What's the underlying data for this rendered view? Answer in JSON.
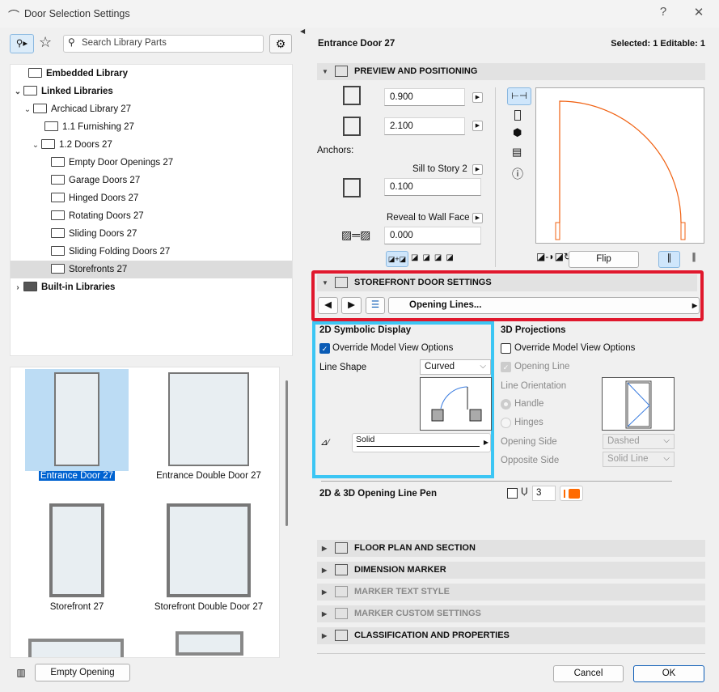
{
  "window": {
    "title": "Door Selection Settings",
    "help": "?",
    "close": "✕"
  },
  "left": {
    "search_placeholder": "Search Library Parts",
    "tree": [
      {
        "label": "Embedded Library",
        "bold": true
      },
      {
        "label": "Linked Libraries",
        "bold": true
      },
      {
        "label": "Archicad Library 27"
      },
      {
        "label": "1.1 Furnishing 27"
      },
      {
        "label": "1.2 Doors 27"
      },
      {
        "label": "Empty Door Openings 27"
      },
      {
        "label": "Garage Doors 27"
      },
      {
        "label": "Hinged Doors 27"
      },
      {
        "label": "Rotating Doors 27"
      },
      {
        "label": "Sliding Doors 27"
      },
      {
        "label": "Sliding Folding Doors 27"
      },
      {
        "label": "Storefronts 27",
        "selected": true
      },
      {
        "label": "Built-in Libraries",
        "bold": true
      }
    ],
    "thumbs": [
      {
        "label": "Entrance Door 27",
        "selected": true
      },
      {
        "label": "Entrance Double Door 27"
      },
      {
        "label": "Storefront 27"
      },
      {
        "label": "Storefront Double Door 27"
      }
    ],
    "empty_opening": "Empty Opening"
  },
  "right": {
    "element_name": "Entrance Door 27",
    "selection_info": "Selected: 1 Editable: 1",
    "preview": {
      "header": "PREVIEW AND POSITIONING",
      "width": "0.900",
      "height": "2.100",
      "anchors_label": "Anchors:",
      "sill_label": "Sill to Story 2",
      "sill_value": "0.100",
      "reveal_label": "Reveal to Wall Face",
      "reveal_value": "0.000",
      "flip": "Flip"
    },
    "storefront": {
      "header": "STOREFRONT DOOR SETTINGS",
      "page": "Opening Lines...",
      "sym": {
        "title": "2D Symbolic Display",
        "override": "Override Model View Options",
        "line_shape_label": "Line Shape",
        "line_shape": "Curved",
        "line_type": "Solid"
      },
      "proj": {
        "title": "3D Projections",
        "override": "Override Model View Options",
        "opening_line": "Opening Line",
        "orientation_label": "Line Orientation",
        "handle": "Handle",
        "hinges": "Hinges",
        "opening_side_label": "Opening Side",
        "opening_side": "Dashed",
        "opposite_side_label": "Opposite Side",
        "opposite_side": "Solid Line"
      },
      "pen_label": "2D & 3D Opening Line Pen",
      "pen_value": "3"
    },
    "sections": [
      "FLOOR PLAN AND SECTION",
      "DIMENSION MARKER",
      "MARKER TEXT STYLE",
      "MARKER CUSTOM SETTINGS",
      "CLASSIFICATION AND PROPERTIES"
    ],
    "cancel": "Cancel",
    "ok": "OK"
  },
  "colors": {
    "accent": "#0a5bb5",
    "highlight_red": "#e0182d",
    "highlight_blue": "#3cc6f4",
    "door_line": "#f06010",
    "pen": "#ff6a00"
  }
}
